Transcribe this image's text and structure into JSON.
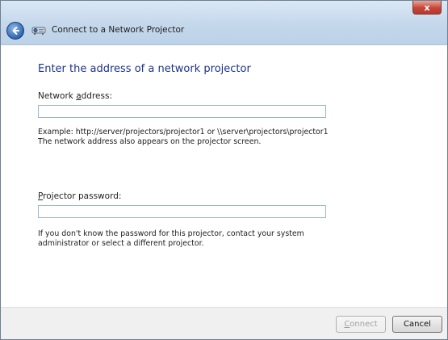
{
  "window": {
    "title": "Connect to a Network Projector",
    "close_symbol": "x",
    "icons": {
      "back": "back-arrow-icon",
      "app": "network-projector-icon",
      "close": "close-icon"
    }
  },
  "main": {
    "heading": "Enter the address of a network projector",
    "network_address": {
      "label_prefix": "Network ",
      "label_accel": "a",
      "label_suffix": "ddress:",
      "value": ""
    },
    "example_line1": "Example: http://server/projectors/projector1 or \\\\server\\projectors\\projector1",
    "example_line2": "The network address also appears on the projector screen.",
    "projector_password": {
      "label_accel": "P",
      "label_suffix": "rojector password:",
      "value": ""
    },
    "password_help_line1": "If you don't know the password for this projector, contact your system",
    "password_help_line2": "administrator or select a different projector."
  },
  "footer": {
    "connect_accel": "C",
    "connect_suffix": "onnect",
    "connect_enabled": false,
    "cancel_label": "Cancel"
  }
}
